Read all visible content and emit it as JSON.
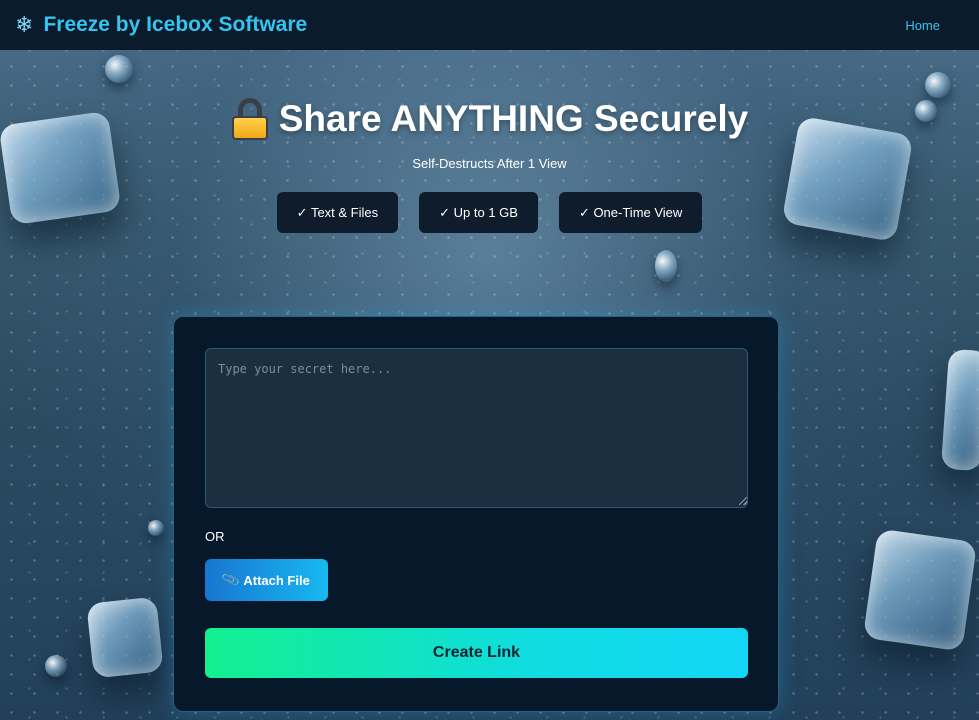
{
  "navbar": {
    "brand_icon": "snowflake-icon",
    "brand_name": "Freeze by Icebox Software",
    "home_link": "Home"
  },
  "hero": {
    "title_icon": "lock-icon",
    "title": "Share ANYTHING Securely",
    "subtitle": "Self-Destructs After 1 View",
    "features": [
      {
        "label": "✓ Text & Files"
      },
      {
        "label": "✓ Up to 1 GB"
      },
      {
        "label": "✓ One-Time View"
      }
    ]
  },
  "form": {
    "secret_value": "",
    "secret_placeholder": "Type your secret here...",
    "or_label": "OR",
    "attach_icon": "paperclip-icon",
    "attach_label": "Attach File",
    "create_label": "Create Link"
  },
  "colors": {
    "navbar_bg": "#0b1b2c",
    "brand": "#35c3ef",
    "card_bg": "#06182a",
    "attach_gradient": [
      "#1976d2",
      "#17b8f0"
    ],
    "create_gradient": [
      "#12f08f",
      "#12d6f5"
    ]
  }
}
